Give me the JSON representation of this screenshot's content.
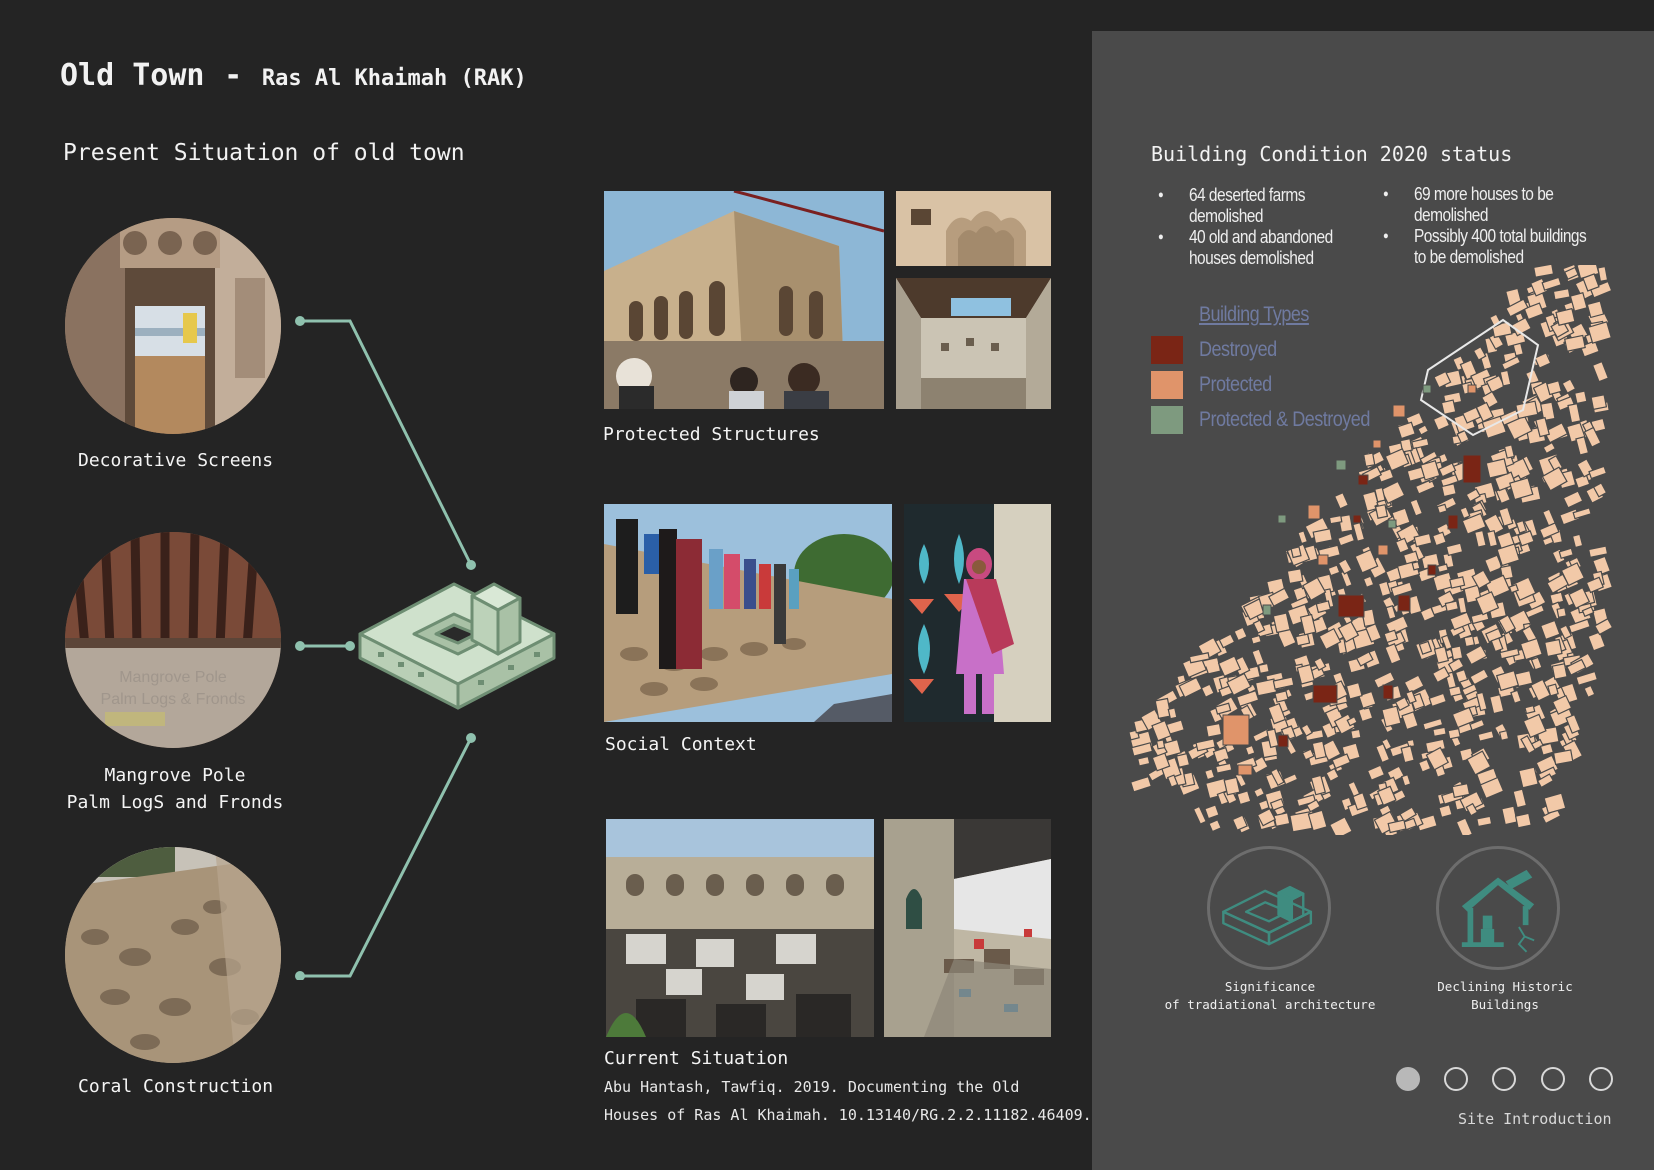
{
  "header": {
    "title_main": "Old Town",
    "title_sep": "-",
    "title_sub": "Ras Al Khaimah (RAK)"
  },
  "left": {
    "section_title": "Present Situation of old town",
    "circles": [
      {
        "caption": "Decorative Screens"
      },
      {
        "caption": "Mangrove Pole\nPalm LogS and Fronds",
        "watermark": "Mangrove Pole\nPalm Logs & Fronds"
      },
      {
        "caption": "Coral Construction"
      }
    ]
  },
  "middle": {
    "groups": [
      {
        "caption": "Protected Structures"
      },
      {
        "caption": "Social Context"
      },
      {
        "caption": "Current Situation"
      }
    ],
    "citation_line1": "Abu Hantash, Tawfiq. 2019. Documenting the Old",
    "citation_line2": "Houses of Ras Al Khaimah. 10.13140/RG.2.2.11182.46409."
  },
  "right": {
    "title": "Building Condition 2020 status",
    "bullets_left": [
      "64 deserted farms demolished",
      "40 old and abandoned houses demolished"
    ],
    "bullets_right": [
      "69 more houses to be demolished",
      "Possibly 400 total buildings to be demolished"
    ],
    "legend_title": "Building Types",
    "legend": [
      {
        "label": "Destroyed",
        "color": "#7a2515"
      },
      {
        "label": "Protected",
        "color": "#e0946a"
      },
      {
        "label": "Protected & Destroyed",
        "color": "#7e9a7f"
      }
    ],
    "badges": [
      {
        "caption": "Significance\nof tradiational architecture",
        "icon": "courtyard-house-icon"
      },
      {
        "caption": "Declining Historic\nBuildings",
        "icon": "collapsing-house-icon"
      }
    ],
    "pagination_total": 5,
    "pagination_active": 1,
    "footer_label": "Site Introduction"
  },
  "colors": {
    "background": "#242424",
    "panel": "#4a4a4a",
    "connector": "#8fc1ae",
    "icon_green": "#cfe1cc",
    "map_building": "#f2c9a8"
  }
}
